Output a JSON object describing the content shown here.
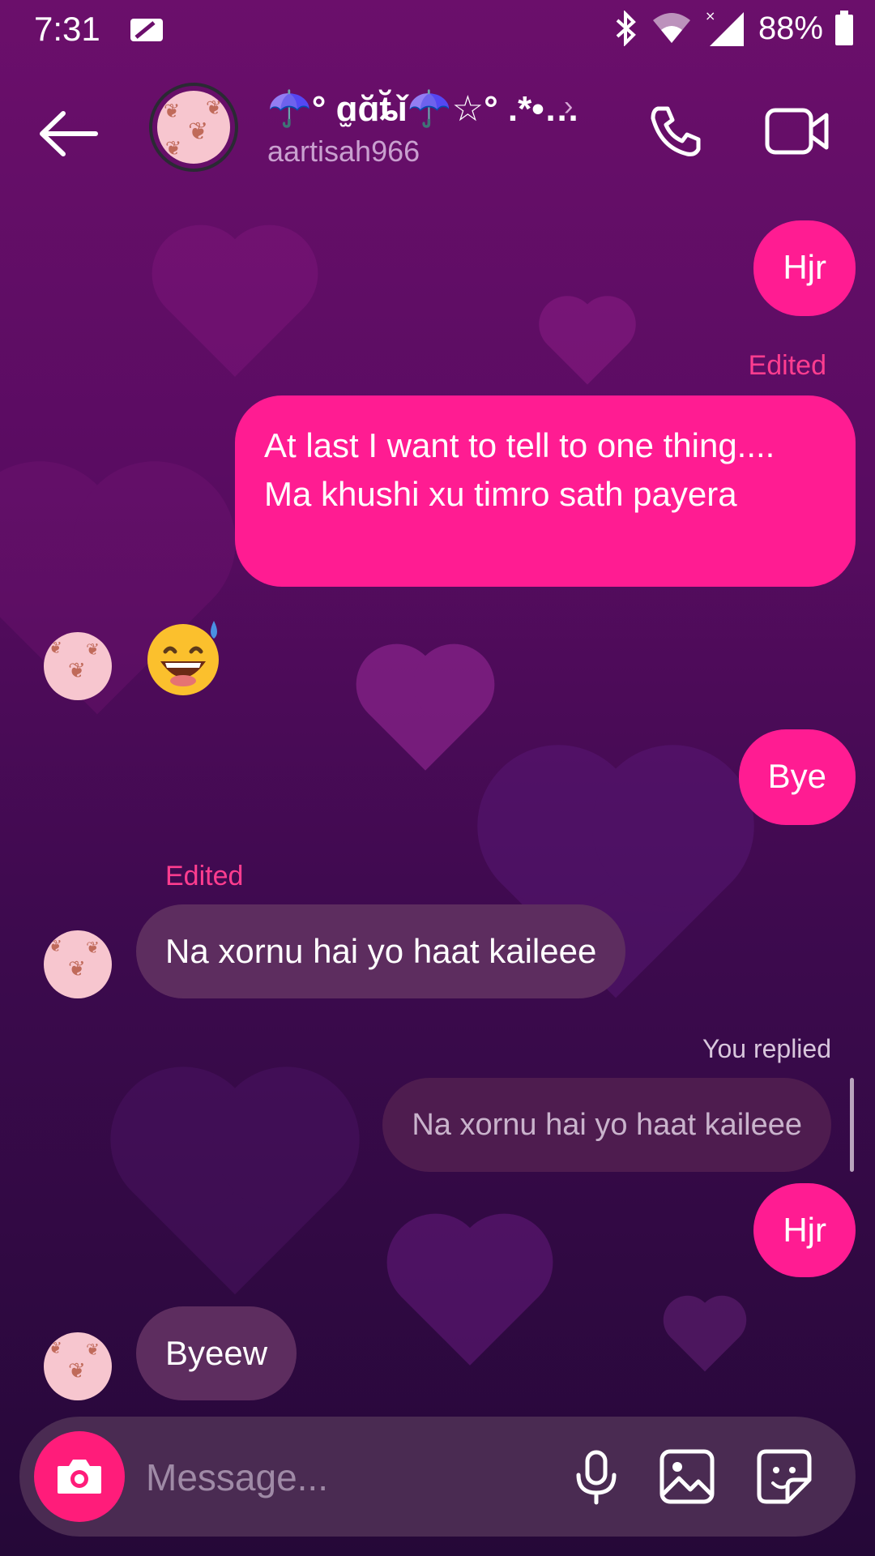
{
  "status_bar": {
    "time": "7:31",
    "battery": "88%",
    "icons": [
      "sim-icon",
      "bluetooth-icon",
      "wifi-icon",
      "signal-icon",
      "battery-icon"
    ]
  },
  "header": {
    "contact_name": "☂️° ɑ̫ɑ̆ȶ̆ǐ☂️☆° .*•…",
    "username": "aartisah966",
    "icons": [
      "back-arrow-icon",
      "chevron-right-icon",
      "phone-icon",
      "video-camera-icon"
    ]
  },
  "messages": [
    {
      "id": "m1",
      "direction": "outgoing",
      "text": "Hjr"
    },
    {
      "id": "m2",
      "direction": "outgoing",
      "text": "At last I want to tell to one thing.... Ma khushi xu timro sath payera",
      "edited_label": "Edited"
    },
    {
      "id": "m3",
      "direction": "incoming",
      "text": "😅",
      "type": "emoji"
    },
    {
      "id": "m4",
      "direction": "outgoing",
      "text": "Bye"
    },
    {
      "id": "m5",
      "direction": "incoming",
      "text": "Na xornu hai yo haat kaileee",
      "edited_label": "Edited"
    },
    {
      "id": "m6",
      "direction": "outgoing",
      "reply_label": "You replied",
      "reply_quote": "Na xornu hai yo haat kaileee",
      "text": "Hjr"
    },
    {
      "id": "m7",
      "direction": "incoming",
      "text": "Byeew"
    }
  ],
  "composer": {
    "placeholder": "Message...",
    "icons": [
      "camera-icon",
      "microphone-icon",
      "gallery-icon",
      "sticker-icon"
    ]
  },
  "colors": {
    "outgoing_bubble": "#ff1c92",
    "incoming_bubble": "#5d2d5f",
    "edited_label": "#ff3d8f",
    "camera_button": "#ff1c7a"
  }
}
